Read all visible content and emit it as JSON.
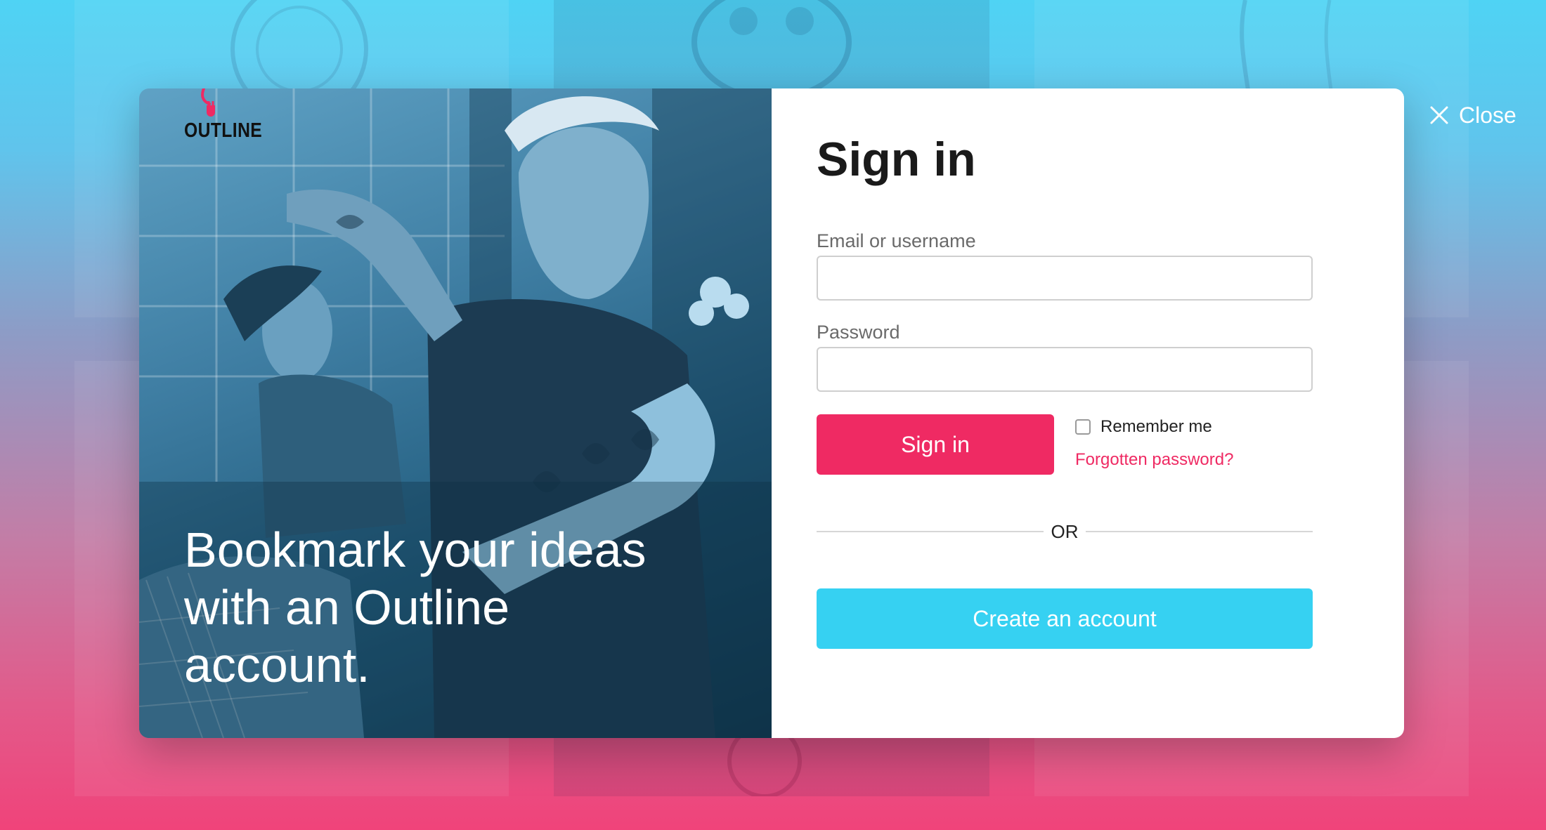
{
  "close": {
    "label": "Close",
    "icon": "close-icon"
  },
  "hero": {
    "logo_text": "OUTLINE",
    "headline": "Bookmark your ideas with an Outline account.",
    "overlay_color": "#1f5e84"
  },
  "signin": {
    "title": "Sign in",
    "email_label": "Email or username",
    "email_value": "",
    "password_label": "Password",
    "password_value": "",
    "submit_label": "Sign in",
    "remember_label": "Remember me",
    "remember_checked": false,
    "forgot_label": "Forgotten password?",
    "or_label": "OR",
    "create_label": "Create an account"
  },
  "colors": {
    "primary": "#ef2a63",
    "secondary": "#36d1f2",
    "background_top": "#4fd3f4",
    "background_bottom": "#f0437a"
  }
}
